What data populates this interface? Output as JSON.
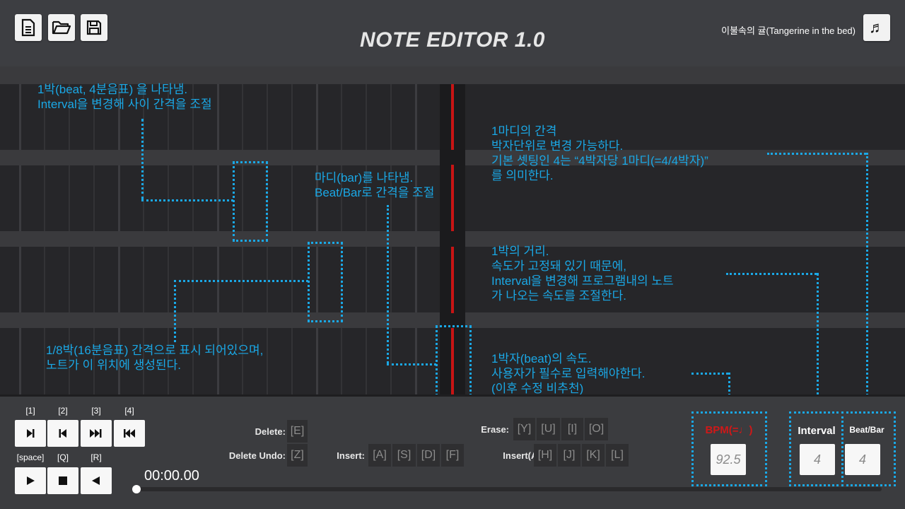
{
  "header": {
    "title": "NOTE EDITOR 1.0",
    "song_name": "이불속의 귤(Tangerine in the bed)",
    "buttons": [
      "new-file-icon",
      "open-folder-icon",
      "save-icon",
      "music-note-icon"
    ]
  },
  "annotations": {
    "beat": "1박(beat, 4분음표) 을 나타냄.\nInterval을 변경해 사이 간격을 조절",
    "bar": "마디(bar)를 나타냄.\nBeat/Bar로 간격을 조절",
    "sixteenth": "1/8박(16분음표) 간격으로 표시 되어있으며,\n노트가 이 위치에 생성된다.",
    "bar_spacing": "1마디의 간격\n박자단위로 변경 가능하다.\n기본 셋팅인 4는 “4박자당 1마디(=4/4박자)”\n를 의미한다.",
    "beat_distance": "1박의 거리.\n속도가 고정돼 있기 때문에,\nInterval을 변경해 프로그램내의 노트\n가 나오는 속도를 조절한다.",
    "bpm_note": "1박자(beat)의 속도.\n사용자가 필수로 입력해야한다.\n(이후 수정 비추천)"
  },
  "playback": {
    "key_labels": [
      "[1]",
      "[2]",
      "[3]",
      "[4]"
    ],
    "key_labels_row2": [
      "[space]",
      "[Q]",
      "[R]"
    ],
    "time": "00:00.00",
    "progress": 0
  },
  "shortcuts": {
    "delete_label": "Delete:",
    "delete_key": "[E]",
    "delete_undo_label": "Delete Undo:",
    "delete_undo_key": "[Z]",
    "insert_label": "Insert:",
    "insert_keys": [
      "[A]",
      "[S]",
      "[D]",
      "[F]"
    ],
    "erase_label": "Erase:",
    "erase_keys": [
      "[Y]",
      "[U]",
      "[I]",
      "[O]"
    ],
    "insert_alt_label": "Insert(Alt):",
    "insert_alt_keys": [
      "[H]",
      "[J]",
      "[K]",
      "[L]"
    ]
  },
  "settings": {
    "bpm_label": "BPM(=♩)",
    "bpm_value": "92.5",
    "interval_label": "Interval",
    "interval_value": "4",
    "beatbar_label": "Beat/Bar",
    "beatbar_value": "4"
  },
  "colors": {
    "accent": "#1aa8e6",
    "bpm_label": "#d01818",
    "playhead": "#c81414"
  }
}
